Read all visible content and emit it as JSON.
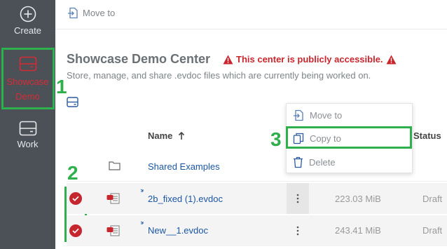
{
  "sidebar": {
    "items": [
      {
        "label": "Create",
        "icon": "plus-circle-icon"
      },
      {
        "label": "Showcase Demo",
        "icon": "drive-icon"
      },
      {
        "label": "Work",
        "icon": "drive-icon"
      }
    ]
  },
  "toolbar": {
    "move_to_label": "Move to"
  },
  "header": {
    "title": "Showcase Demo Center",
    "warning": "This center is publicly accessible.",
    "subtitle": "Store, manage, and share .evdoc files which are currently being worked on."
  },
  "table": {
    "columns": {
      "name": "Name",
      "status": "Status"
    },
    "rows": [
      {
        "name": "Shared Examples",
        "type": "folder",
        "size": "",
        "status": ""
      },
      {
        "name": "2b_fixed (1).evdoc",
        "type": "evdoc",
        "size": "223.03 MiB",
        "status": "Draft"
      },
      {
        "name": "New__1.evdoc",
        "type": "evdoc",
        "size": "243.41 MiB",
        "status": "Draft"
      }
    ]
  },
  "context_menu": {
    "items": [
      {
        "label": "Move to",
        "icon": "move-to-icon"
      },
      {
        "label": "Copy to",
        "icon": "copy-icon"
      },
      {
        "label": "Delete",
        "icon": "trash-icon"
      }
    ]
  },
  "annotations": {
    "one": "1",
    "two": "2",
    "three": "3"
  },
  "colors": {
    "sidebar": "#4b5157",
    "accent_red": "#c6262e",
    "highlight_green": "#2fb04c",
    "link_blue": "#1a56a6"
  }
}
